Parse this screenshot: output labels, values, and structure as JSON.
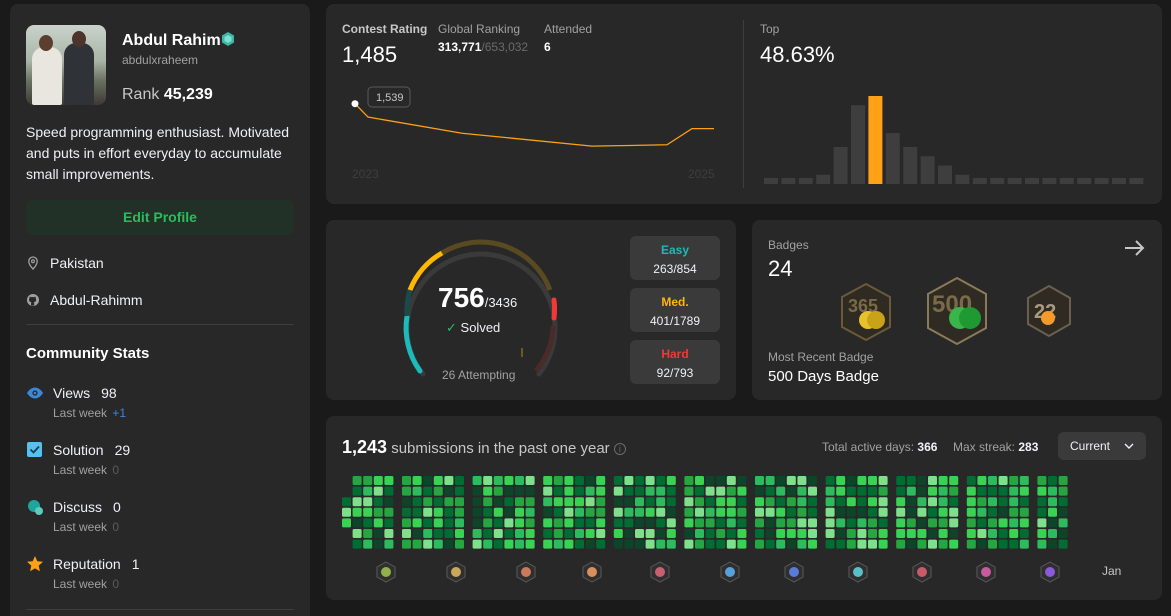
{
  "profile": {
    "name": "Abdul Rahim",
    "username": "abdulxraheem",
    "rank_label": "Rank",
    "rank_value": "45,239",
    "bio": "Speed programming enthusiast. Motivated and puts in effort everyday to accumulate small improvements.",
    "edit_button": "Edit Profile",
    "location": "Pakistan",
    "github": "Abdul-Rahimm"
  },
  "community": {
    "title": "Community Stats",
    "stats": [
      {
        "label": "Views",
        "value": "98",
        "sub_label": "Last week",
        "sub_value": "+1",
        "icon": "eye-icon",
        "color": "#3c87d8"
      },
      {
        "label": "Solution",
        "value": "29",
        "sub_label": "Last week",
        "sub_value": "0",
        "icon": "solution-icon",
        "color": "#54c1f2"
      },
      {
        "label": "Discuss",
        "value": "0",
        "sub_label": "Last week",
        "sub_value": "0",
        "icon": "discuss-icon",
        "color": "#1fa59b"
      },
      {
        "label": "Reputation",
        "value": "1",
        "sub_label": "Last week",
        "sub_value": "0",
        "icon": "star-icon",
        "color": "#ffa116"
      }
    ]
  },
  "contest": {
    "rating_label": "Contest Rating",
    "rating_value": "1,485",
    "global_label": "Global Ranking",
    "global_value": "313,771",
    "global_total": "/653,032",
    "attended_label": "Attended",
    "attended_value": "6",
    "top_label": "Top",
    "top_value": "48.63%",
    "tooltip": "1,539",
    "x_start": "2023",
    "x_end": "2025"
  },
  "solved": {
    "count": "756",
    "total": "/3436",
    "solved_label": "Solved",
    "attempting": "26 Attempting",
    "easy_label": "Easy",
    "easy_value": "263/854",
    "med_label": "Med.",
    "med_value": "401/1789",
    "hard_label": "Hard",
    "hard_value": "92/793"
  },
  "badges": {
    "title": "Badges",
    "count": "24",
    "recent_label": "Most Recent Badge",
    "recent_name": "500 Days Badge",
    "items": [
      "365-days-badge",
      "500-days-badge",
      "2022-badge"
    ]
  },
  "submissions": {
    "count": "1,243",
    "label": "submissions in the past one year",
    "active_label": "Total active days:",
    "active_value": "366",
    "streak_label": "Max streak:",
    "streak_value": "283",
    "period_button": "Current",
    "month_labels": [
      "Jan"
    ]
  },
  "chart_data": [
    {
      "type": "line",
      "x": [
        "2023",
        "",
        "",
        "",
        "",
        "",
        "2025"
      ],
      "values": [
        1539,
        1510,
        1475,
        1447,
        1450,
        1485,
        1485
      ],
      "xlabel": "",
      "ylabel": ""
    },
    {
      "type": "bar",
      "values": [
        1,
        1,
        1,
        2,
        8,
        17,
        19,
        11,
        8,
        6,
        4,
        2,
        1,
        1,
        1,
        1,
        1,
        1,
        1,
        1,
        1,
        1
      ],
      "highlight_index": 6,
      "xlabel": "",
      "ylabel": ""
    }
  ],
  "colors": {
    "easy": "#1cbaba",
    "medium": "#ffb700",
    "hard": "#f63737",
    "green": "#2cbb5d",
    "accent": "#ffa116"
  }
}
